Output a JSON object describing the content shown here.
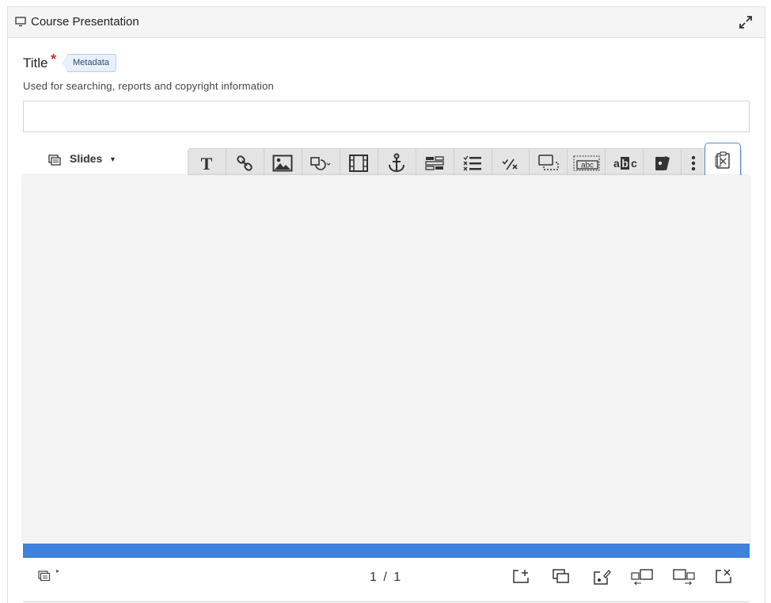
{
  "header": {
    "title": "Course Presentation",
    "icon": "monitor-icon",
    "expand_icon": "expand-icon"
  },
  "form": {
    "title_label": "Title",
    "required_mark": "*",
    "metadata_label": "Metadata",
    "description": "Used for searching, reports and copyright information",
    "title_value": ""
  },
  "slides_menu": {
    "label": "Slides",
    "icon": "slides-icon"
  },
  "toolbar": {
    "items": [
      {
        "name": "text-icon"
      },
      {
        "name": "link-icon"
      },
      {
        "name": "image-icon"
      },
      {
        "name": "shapes-icon"
      },
      {
        "name": "video-icon"
      },
      {
        "name": "go-to-slide-icon"
      },
      {
        "name": "drag-text-icon"
      },
      {
        "name": "single-choice-icon"
      },
      {
        "name": "true-false-icon"
      },
      {
        "name": "summary-icon"
      },
      {
        "name": "fill-blanks-icon"
      },
      {
        "name": "mark-words-icon"
      },
      {
        "name": "dialog-cards-icon"
      },
      {
        "name": "more-icon"
      }
    ],
    "active_icon": "paste-icon"
  },
  "colors": {
    "progress": "#3e82db",
    "active_border": "#5b8cc5"
  },
  "footer": {
    "page_counter": "1 / 1",
    "icons": [
      "add-slide-icon",
      "clone-slide-icon",
      "slide-background-icon",
      "move-slide-left-icon",
      "move-slide-right-icon",
      "delete-slide-icon"
    ]
  }
}
